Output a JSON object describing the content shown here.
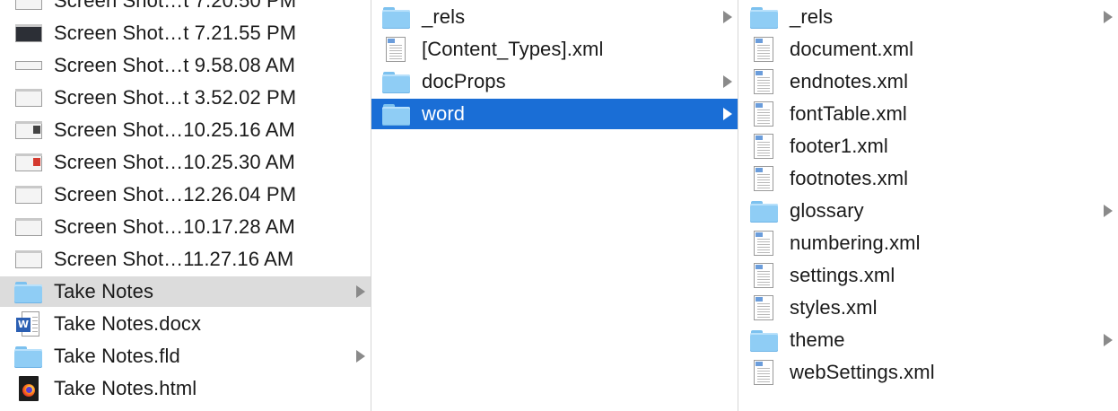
{
  "column1": {
    "items": [
      {
        "label": "Screen Shot…t 7.20.50 PM",
        "kind": "screenshot",
        "variant": "light"
      },
      {
        "label": "Screen Shot…t 7.21.55 PM",
        "kind": "screenshot",
        "variant": "dark"
      },
      {
        "label": "Screen Shot…t 9.58.08 AM",
        "kind": "screenshot",
        "variant": "stripe"
      },
      {
        "label": "Screen Shot…t 3.52.02 PM",
        "kind": "screenshot",
        "variant": "light"
      },
      {
        "label": "Screen Shot…10.25.16 AM",
        "kind": "screenshot",
        "variant": "accent"
      },
      {
        "label": "Screen Shot…10.25.30 AM",
        "kind": "screenshot",
        "variant": "red"
      },
      {
        "label": "Screen Shot…12.26.04 PM",
        "kind": "screenshot",
        "variant": "light"
      },
      {
        "label": "Screen Shot…10.17.28 AM",
        "kind": "screenshot",
        "variant": "light"
      },
      {
        "label": "Screen Shot…11.27.16 AM",
        "kind": "screenshot",
        "variant": "light"
      },
      {
        "label": "Take Notes",
        "kind": "folder",
        "selected": "inactive"
      },
      {
        "label": "Take Notes.docx",
        "kind": "word-doc"
      },
      {
        "label": "Take Notes.fld",
        "kind": "folder"
      },
      {
        "label": "Take Notes.html",
        "kind": "html-doc"
      }
    ]
  },
  "column2": {
    "items": [
      {
        "label": "_rels",
        "kind": "folder"
      },
      {
        "label": "[Content_Types].xml",
        "kind": "xml-doc"
      },
      {
        "label": "docProps",
        "kind": "folder"
      },
      {
        "label": "word",
        "kind": "folder",
        "selected": "active"
      }
    ]
  },
  "column3": {
    "items": [
      {
        "label": "_rels",
        "kind": "folder"
      },
      {
        "label": "document.xml",
        "kind": "xml-doc"
      },
      {
        "label": "endnotes.xml",
        "kind": "xml-doc"
      },
      {
        "label": "fontTable.xml",
        "kind": "xml-doc"
      },
      {
        "label": "footer1.xml",
        "kind": "xml-doc"
      },
      {
        "label": "footnotes.xml",
        "kind": "xml-doc"
      },
      {
        "label": "glossary",
        "kind": "folder"
      },
      {
        "label": "numbering.xml",
        "kind": "xml-doc"
      },
      {
        "label": "settings.xml",
        "kind": "xml-doc"
      },
      {
        "label": "styles.xml",
        "kind": "xml-doc"
      },
      {
        "label": "theme",
        "kind": "folder"
      },
      {
        "label": "webSettings.xml",
        "kind": "xml-doc"
      }
    ]
  },
  "colors": {
    "selection_active": "#1a6ed6",
    "selection_inactive": "#dcdcdc",
    "folder": "#8fcdf5"
  }
}
